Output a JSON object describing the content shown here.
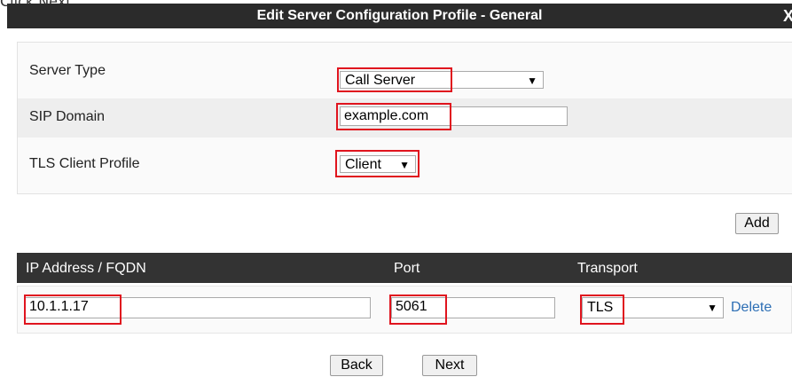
{
  "caption": "Click Next.",
  "window": {
    "title": "Edit Server Configuration Profile - General",
    "close_label": "X"
  },
  "general": {
    "server_type_label": "Server Type",
    "server_type_value": "Call Server",
    "sip_domain_label": "SIP Domain",
    "sip_domain_value": "example.com",
    "tls_label": "TLS Client Profile",
    "tls_value": "Client"
  },
  "buttons": {
    "add": "Add",
    "back": "Back",
    "next": "Next"
  },
  "servers_table": {
    "headers": [
      "IP Address / FQDN",
      "Port",
      "Transport"
    ],
    "rows": [
      {
        "ip": "10.1.1.17",
        "port": "5061",
        "transport": "TLS",
        "action": "Delete"
      }
    ]
  },
  "icons": {
    "dropdown": "chevron-down-icon"
  },
  "colors": {
    "highlight": "#e0141e",
    "header_bg": "#333333",
    "link": "#2d6fb5"
  }
}
